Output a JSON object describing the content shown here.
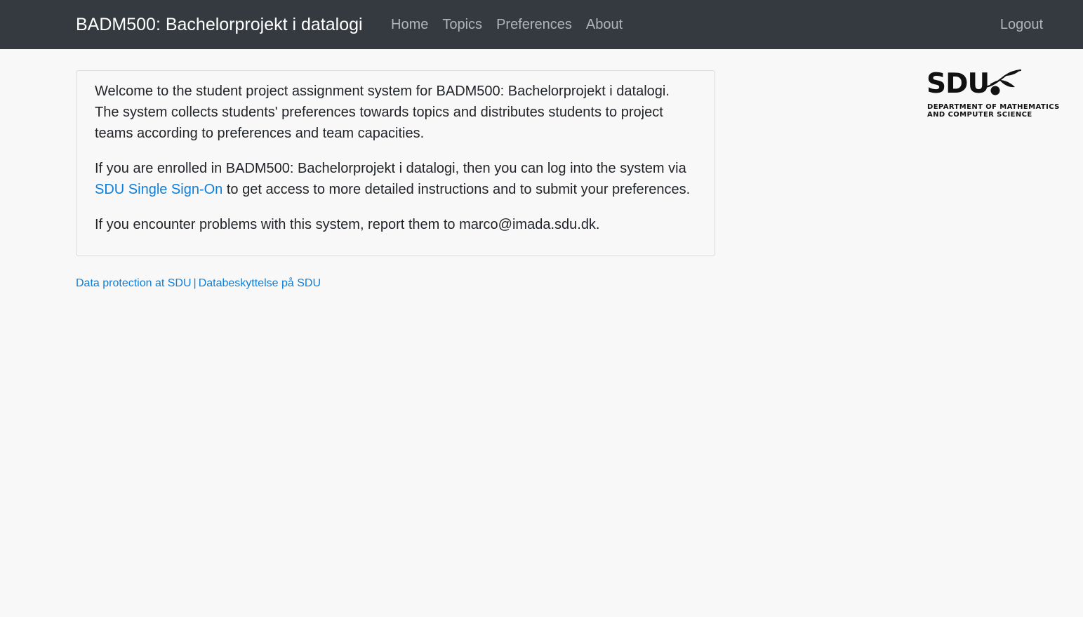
{
  "navbar": {
    "brand": "BADM500: Bachelorprojekt i datalogi",
    "links": [
      {
        "label": "Home"
      },
      {
        "label": "Topics"
      },
      {
        "label": "Preferences"
      },
      {
        "label": "About"
      }
    ],
    "logout_label": "Logout"
  },
  "content": {
    "para1": "Welcome to the student project assignment system for BADM500: Bachelorprojekt i datalogi. The system collects students' preferences towards topics and distributes students to project teams according to preferences and team capacities.",
    "para2_before": "If you are enrolled in BADM500: Bachelorprojekt i datalogi, then you can log into the system via ",
    "para2_link": "SDU Single Sign-On",
    "para2_after": " to get access to more detailed instructions and to submit your preferences.",
    "para3": "If you encounter problems with this system, report them to marco@imada.sdu.dk."
  },
  "footer": {
    "link1": "Data protection at SDU",
    "separator": "|",
    "link2": "Databeskyttelse på SDU"
  },
  "logo": {
    "wordmark": "SDU",
    "line1": "DEPARTMENT OF MATHEMATICS",
    "line2": "AND COMPUTER SCIENCE"
  },
  "colors": {
    "navbar_bg": "#343a40",
    "link": "#0d7fdb",
    "page_bg": "#f8f8f8"
  }
}
